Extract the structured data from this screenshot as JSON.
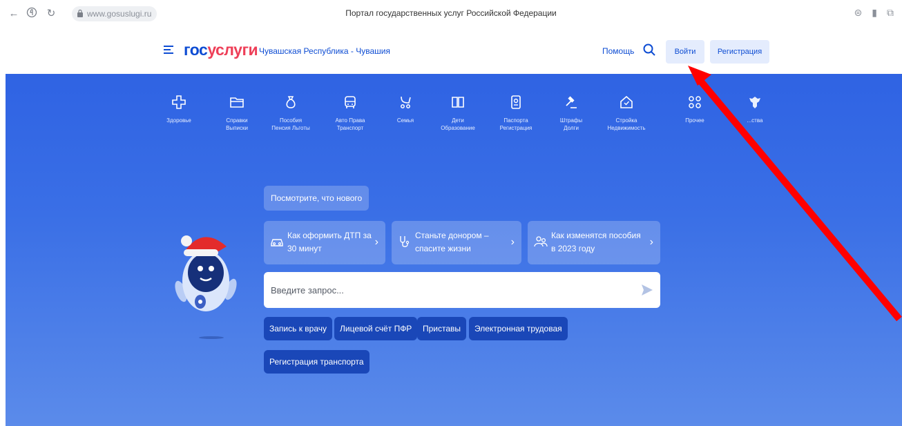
{
  "browser": {
    "url": "www.gosuslugi.ru",
    "title": "Портал государственных услуг Российской Федерации"
  },
  "header": {
    "logo_part1": "гос",
    "logo_part2": "услуги",
    "region": "Чувашская Республика - Чувашия",
    "help": "Помощь",
    "login": "Войти",
    "register": "Регистрация"
  },
  "categories": [
    {
      "label": "Здоровье",
      "icon": "plus-cross-icon"
    },
    {
      "label": "Справки\nВыписки",
      "icon": "folder-icon"
    },
    {
      "label": "Пособия\nПенсия Льготы",
      "icon": "money-bag-icon"
    },
    {
      "label": "Авто Права\nТранспорт",
      "icon": "bus-icon"
    },
    {
      "label": "Семья",
      "icon": "stroller-icon"
    },
    {
      "label": "Дети\nОбразование",
      "icon": "book-icon"
    },
    {
      "label": "Паспорта\nРегистрация",
      "icon": "passport-icon"
    },
    {
      "label": "Штрафы\nДолги",
      "icon": "gavel-icon"
    },
    {
      "label": "Стройка\nНедвижимость",
      "icon": "house-icon"
    },
    {
      "label": "Прочее",
      "icon": "grid-icon"
    },
    {
      "label": "...ства",
      "icon": "emblem-icon"
    }
  ],
  "hero": {
    "news_label": "Посмотрите, что нового",
    "cards": [
      {
        "line1": "Как оформить ДТП за",
        "line2": "30 минут",
        "icon": "car-icon"
      },
      {
        "line1": "Станьте донором –",
        "line2": "спасите жизни",
        "icon": "stethoscope-icon"
      },
      {
        "line1": "Как изменятся пособия",
        "line2": "в 2023 году",
        "icon": "people-icon"
      }
    ],
    "search_placeholder": "Введите запрос...",
    "chips": [
      "Запись к врачу",
      "Лицевой счёт ПФР",
      "Приставы",
      "Электронная трудовая",
      "Регистрация транспорта"
    ]
  },
  "colors": {
    "brand_blue": "#0d4cd3",
    "brand_red": "#ee3f58",
    "hero_top": "#2f63e3",
    "annotation_arrow": "#ff0000"
  }
}
